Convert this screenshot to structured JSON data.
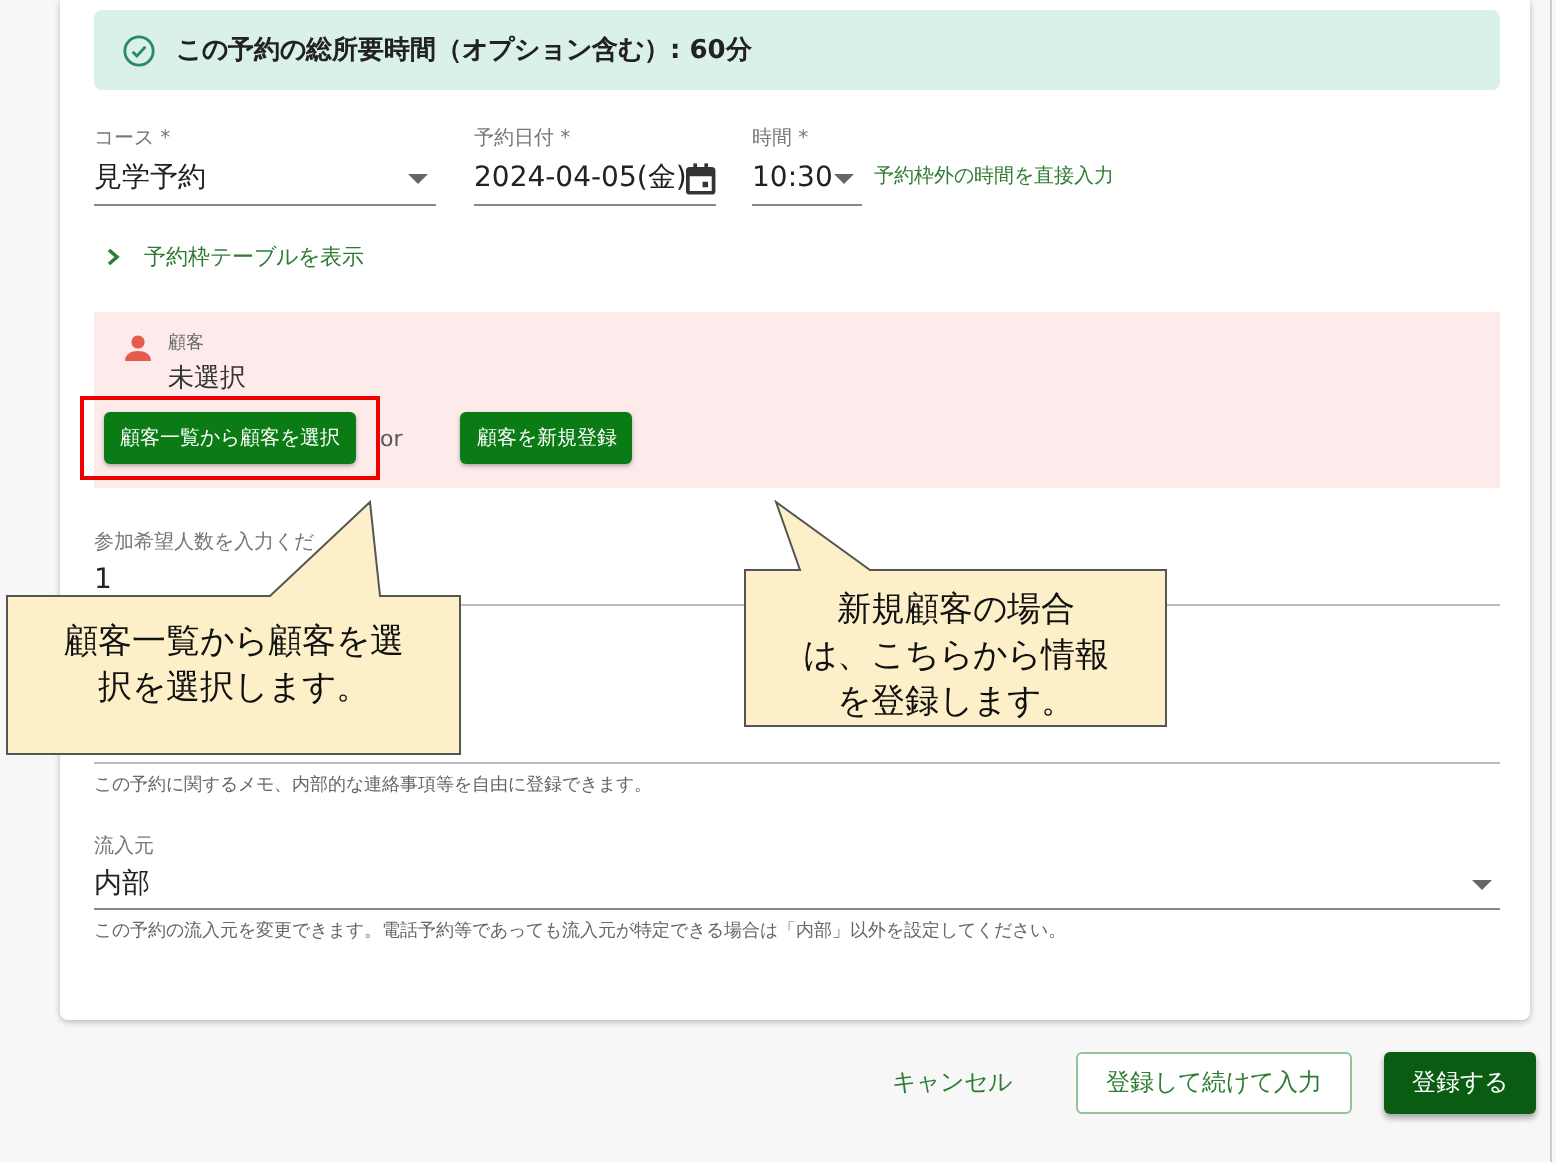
{
  "summary": {
    "text": "この予約の総所要時間（オプション含む）: 60分"
  },
  "course": {
    "label": "コース *",
    "value": "見学予約"
  },
  "date": {
    "label": "予約日付 *",
    "value": "2024-04-05(金)"
  },
  "time": {
    "label": "時間 *",
    "value": "10:30",
    "link": "予約枠外の時間を直接入力"
  },
  "table_toggle": {
    "label": "予約枠テーブルを表示",
    "expanded": false
  },
  "customer": {
    "label": "顧客",
    "value": "未選択",
    "separator": "or",
    "buttons": [
      {
        "label": "顧客一覧から顧客を選択",
        "highlighted": true
      },
      {
        "label": "顧客を新規登録",
        "highlighted": false
      }
    ]
  },
  "participants": {
    "label": "参加希望人数を入力くだ",
    "value": "1"
  },
  "memo": {
    "hint": "この予約に関するメモ、内部的な連絡事項等を自由に登録できます。"
  },
  "source": {
    "label": "流入元",
    "value": "内部",
    "hint": "この予約の流入元を変更できます。電話予約等であっても流入元が特定できる場合は「内部」以外を設定してください。"
  },
  "actions": [
    {
      "label": "キャンセル",
      "kind": "text"
    },
    {
      "label": "登録して続けて入力",
      "kind": "outlined"
    },
    {
      "label": "登録する",
      "kind": "primary"
    }
  ],
  "callouts": [
    {
      "lines": [
        "顧客一覧から顧客を選",
        "択を選択します。"
      ]
    },
    {
      "lines": [
        "新規顧客の場合",
        "は、こちらから情報",
        "を登録します。"
      ]
    }
  ]
}
